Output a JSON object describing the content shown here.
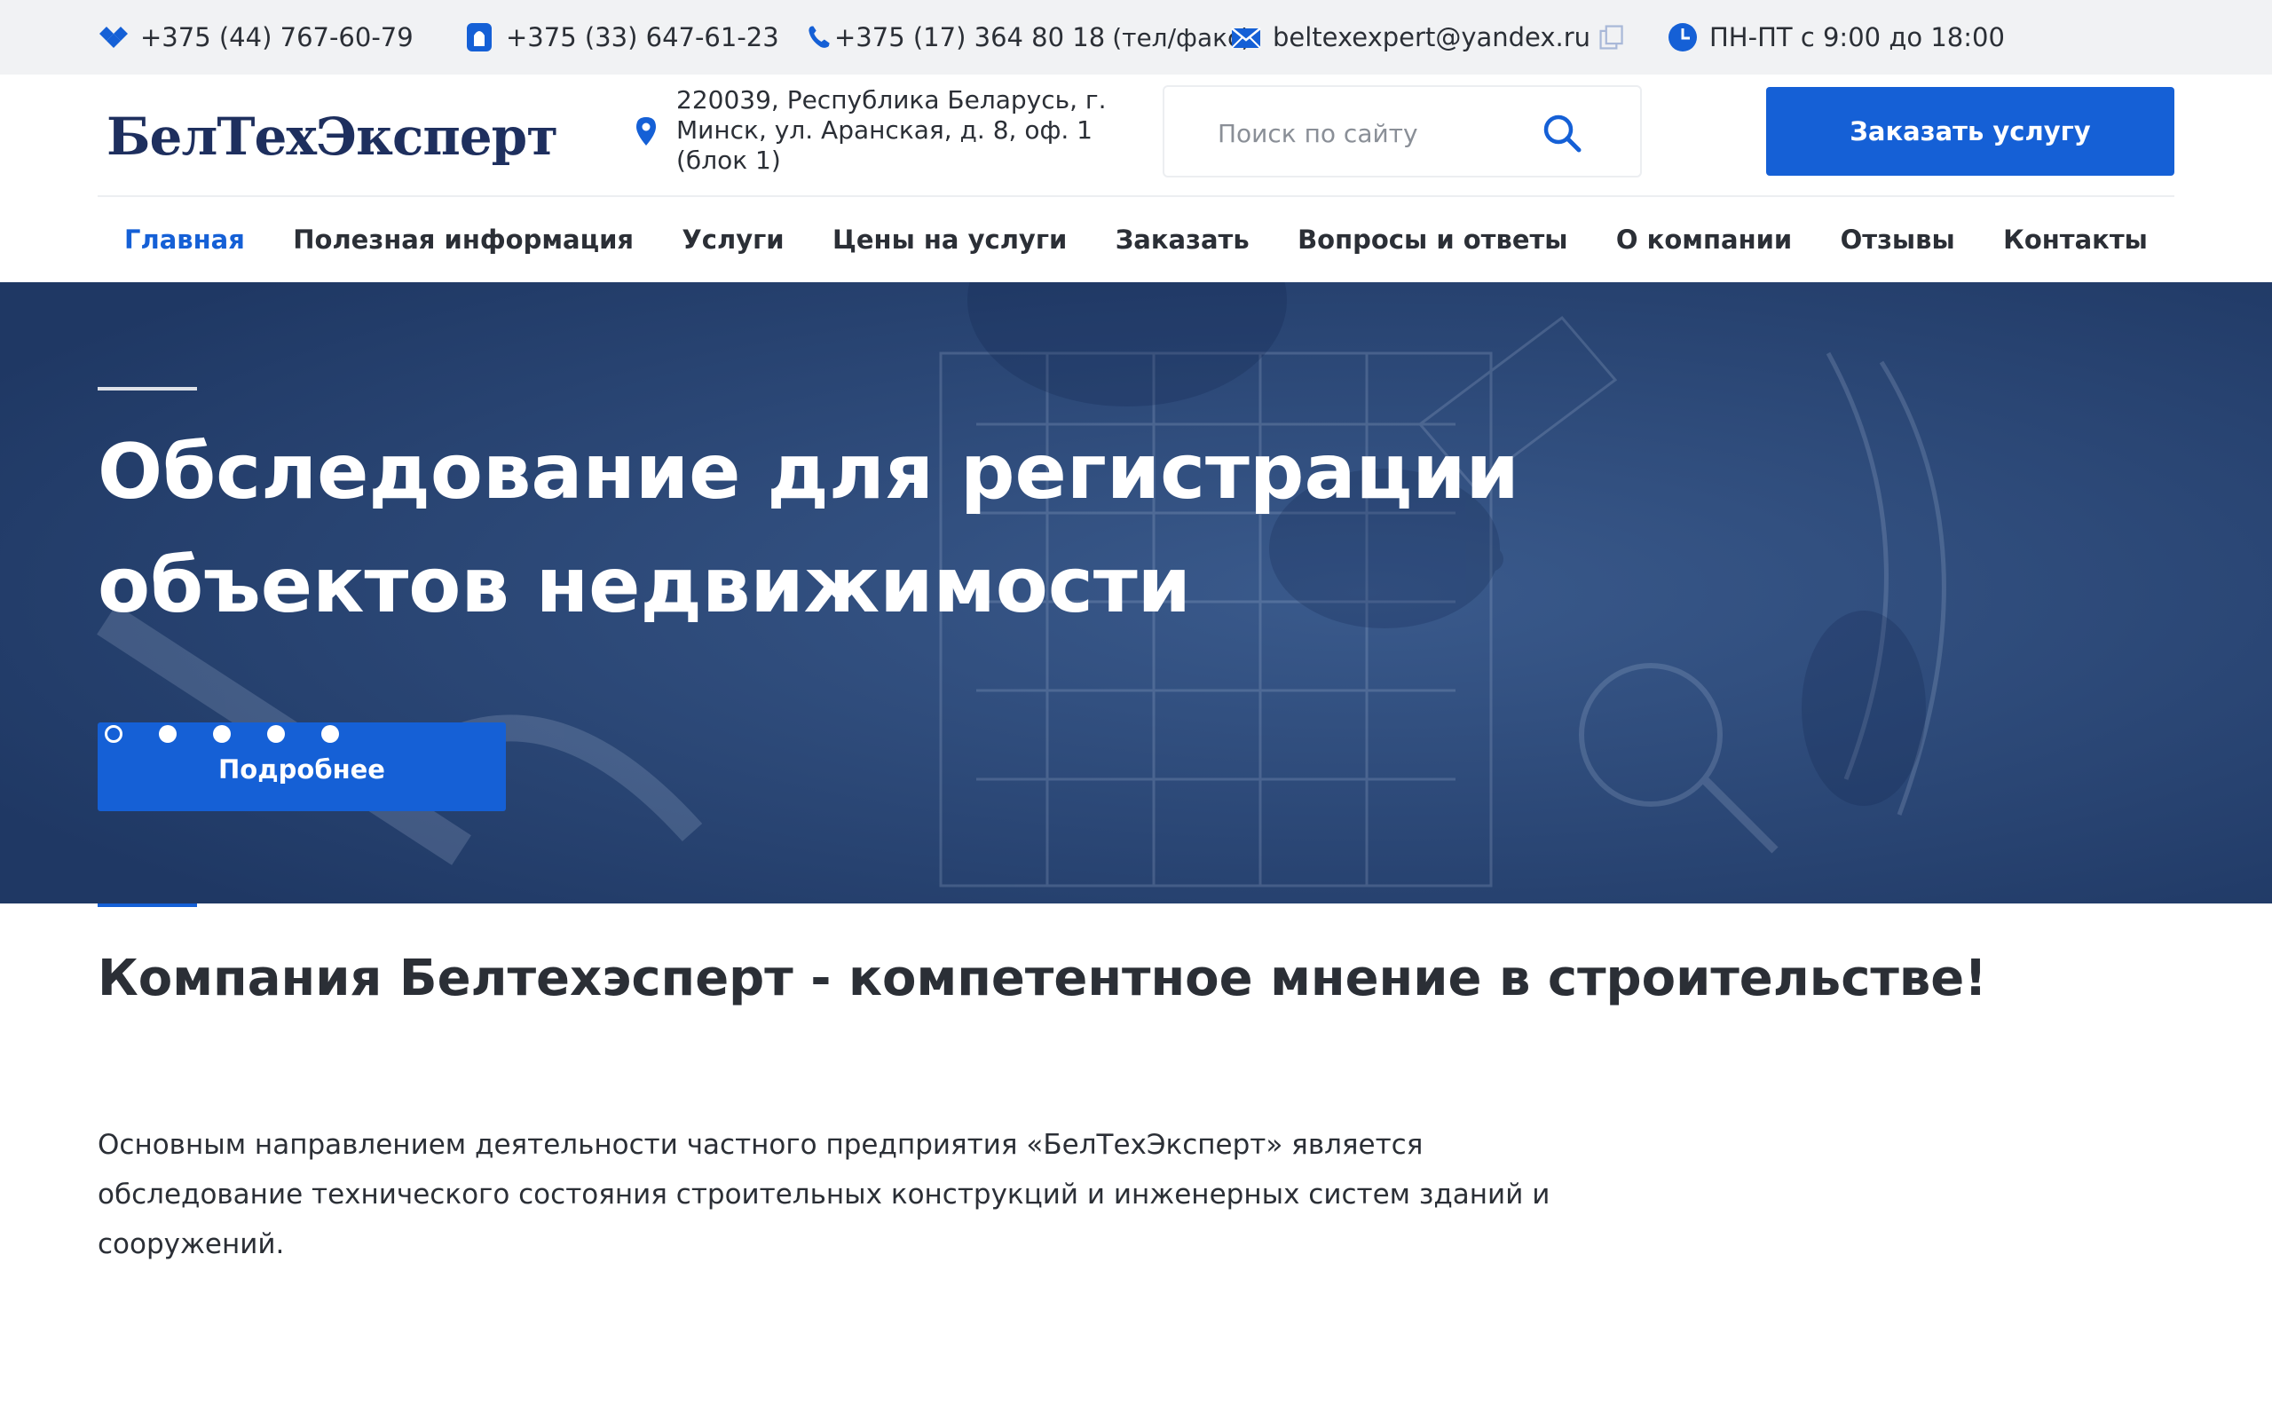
{
  "topbar": {
    "phone1": "+375 (44) 767-60-79",
    "phone2": "+375 (33) 647-61-23",
    "phone3": "+375 (17) 364 80 18",
    "phone3_note": "(тел/факс)",
    "email": "beltexexpert@yandex.ru",
    "hours": "ПН-ПТ с 9:00 до 18:00",
    "icon_phone1": "viber-diamond-icon",
    "icon_phone2": "life-sim-icon",
    "icon_phone3": "phone-icon",
    "icon_email": "envelope-icon",
    "icon_copy": "copy-icon",
    "icon_hours": "clock-icon"
  },
  "header": {
    "logo_text": "БелТехЭксперт",
    "address": "220039, Республика Беларусь, г. Минск, ул. Аранская, д. 8, оф. 1 (блок 1)",
    "search_placeholder": "Поиск по сайту",
    "order_button": "Заказать услугу"
  },
  "nav": {
    "items": [
      {
        "label": "Главная"
      },
      {
        "label": "Полезная информация"
      },
      {
        "label": "Услуги"
      },
      {
        "label": "Цены на услуги"
      },
      {
        "label": "Заказать"
      },
      {
        "label": "Вопросы и ответы"
      },
      {
        "label": "О компании"
      },
      {
        "label": "Отзывы"
      },
      {
        "label": "Контакты"
      }
    ],
    "active_index": 0
  },
  "hero": {
    "title_line1": "Обследование для регистрации",
    "title_line2": "объектов недвижимости",
    "button": "Подробнее",
    "slides_count": 5,
    "active_slide": 0
  },
  "content": {
    "heading": "Компания Белтехэсперт - компетентное мнение в строительстве!",
    "paragraph_line1": "Основным направлением деятельности частного предприятия «БелТехЭксперт» является",
    "paragraph_line2": "обследование технического состояния строительных конструкций и инженерных систем зданий и",
    "paragraph_line3": "сооружений."
  },
  "colors": {
    "accent": "#1560d6",
    "hero_overlay": "#23406f",
    "topbar_bg": "#f1f2f4",
    "text": "#2b2f36"
  }
}
